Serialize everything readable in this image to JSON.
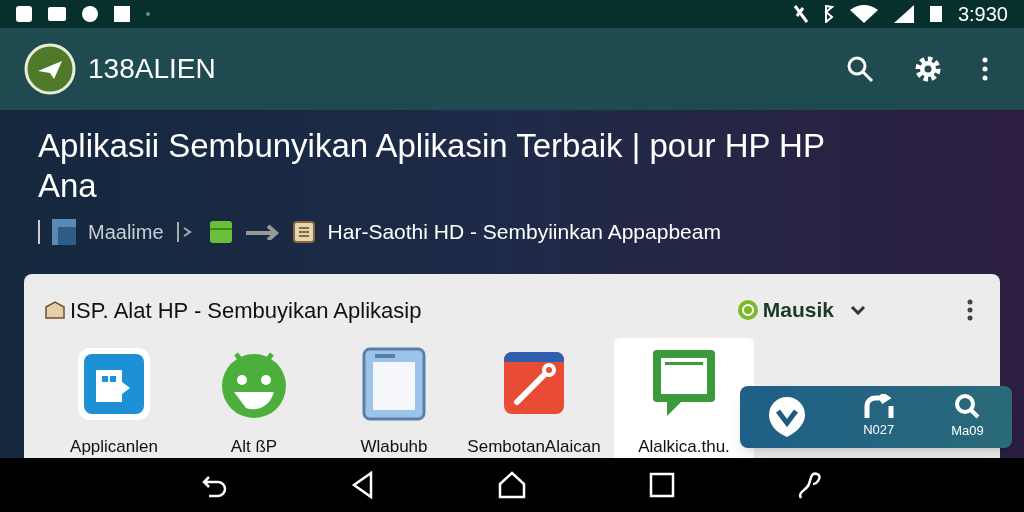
{
  "status_bar": {
    "time": "3:930"
  },
  "app_bar": {
    "title": "138ALIEN"
  },
  "page": {
    "title": "Aplikasii Sembunyikan Aplikasin Terbaik | pour HP HP Ana",
    "breadcrumb": [
      {
        "label": "Maalime"
      },
      {
        "label": "Har-Saothi HD - Sembyiinkan Appapbeam"
      }
    ]
  },
  "card": {
    "title": "ISP. Alat HP - Sembuyikan Aplikasip",
    "dropdown": "Mausik",
    "apps": [
      {
        "label": "Applicanlen",
        "kind": "puzzle",
        "selected": false
      },
      {
        "label": "Alt ßP",
        "kind": "android",
        "selected": false
      },
      {
        "label": "Wlabuhb",
        "kind": "tablet",
        "selected": false
      },
      {
        "label": "SembotanAlaican",
        "kind": "pen",
        "selected": false
      },
      {
        "label": "Alalkica.thu.",
        "kind": "chat",
        "selected": true
      }
    ]
  },
  "toolbar": [
    {
      "kind": "check"
    },
    {
      "kind": "home",
      "label": "N027"
    },
    {
      "kind": "search",
      "label": "Ma09"
    }
  ]
}
